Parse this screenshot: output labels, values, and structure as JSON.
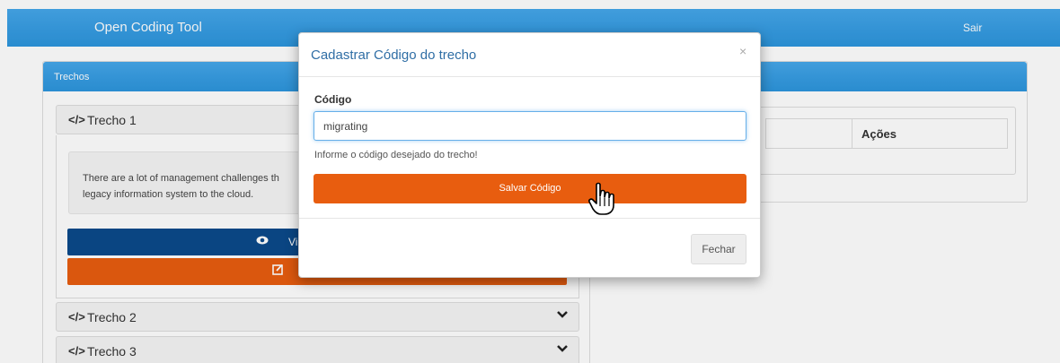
{
  "navbar": {
    "brand": "Open Coding Tool",
    "logout_label": "Sair"
  },
  "left_panel": {
    "title": "Trechos",
    "trechos": [
      {
        "label": "Trecho 1",
        "expanded": true
      },
      {
        "label": "Trecho 2",
        "expanded": false
      },
      {
        "label": "Trecho 3",
        "expanded": false
      }
    ],
    "trecho_text": "There are a lot of management challenges th\nlegacy information system to the cloud.",
    "view_button_label": "Vi",
    "icons": {
      "code": "code-icon",
      "eye": "eye-icon",
      "edit": "edit-icon",
      "chevron": "chevron-down-icon"
    }
  },
  "right_panel": {
    "column_acoes": "Ações"
  },
  "modal": {
    "title": "Cadastrar Código do trecho",
    "close_symbol": "×",
    "field_label": "Código",
    "field_value": "migrating",
    "help_text": "Informe o código desejado do trecho!",
    "save_label": "Salvar Código",
    "close_label": "Fechar"
  },
  "colors": {
    "primary_blue": "#2c95dd",
    "dark_blue": "#0b4a8b",
    "orange": "#e85d0f",
    "title_blue": "#2f6ea5"
  }
}
